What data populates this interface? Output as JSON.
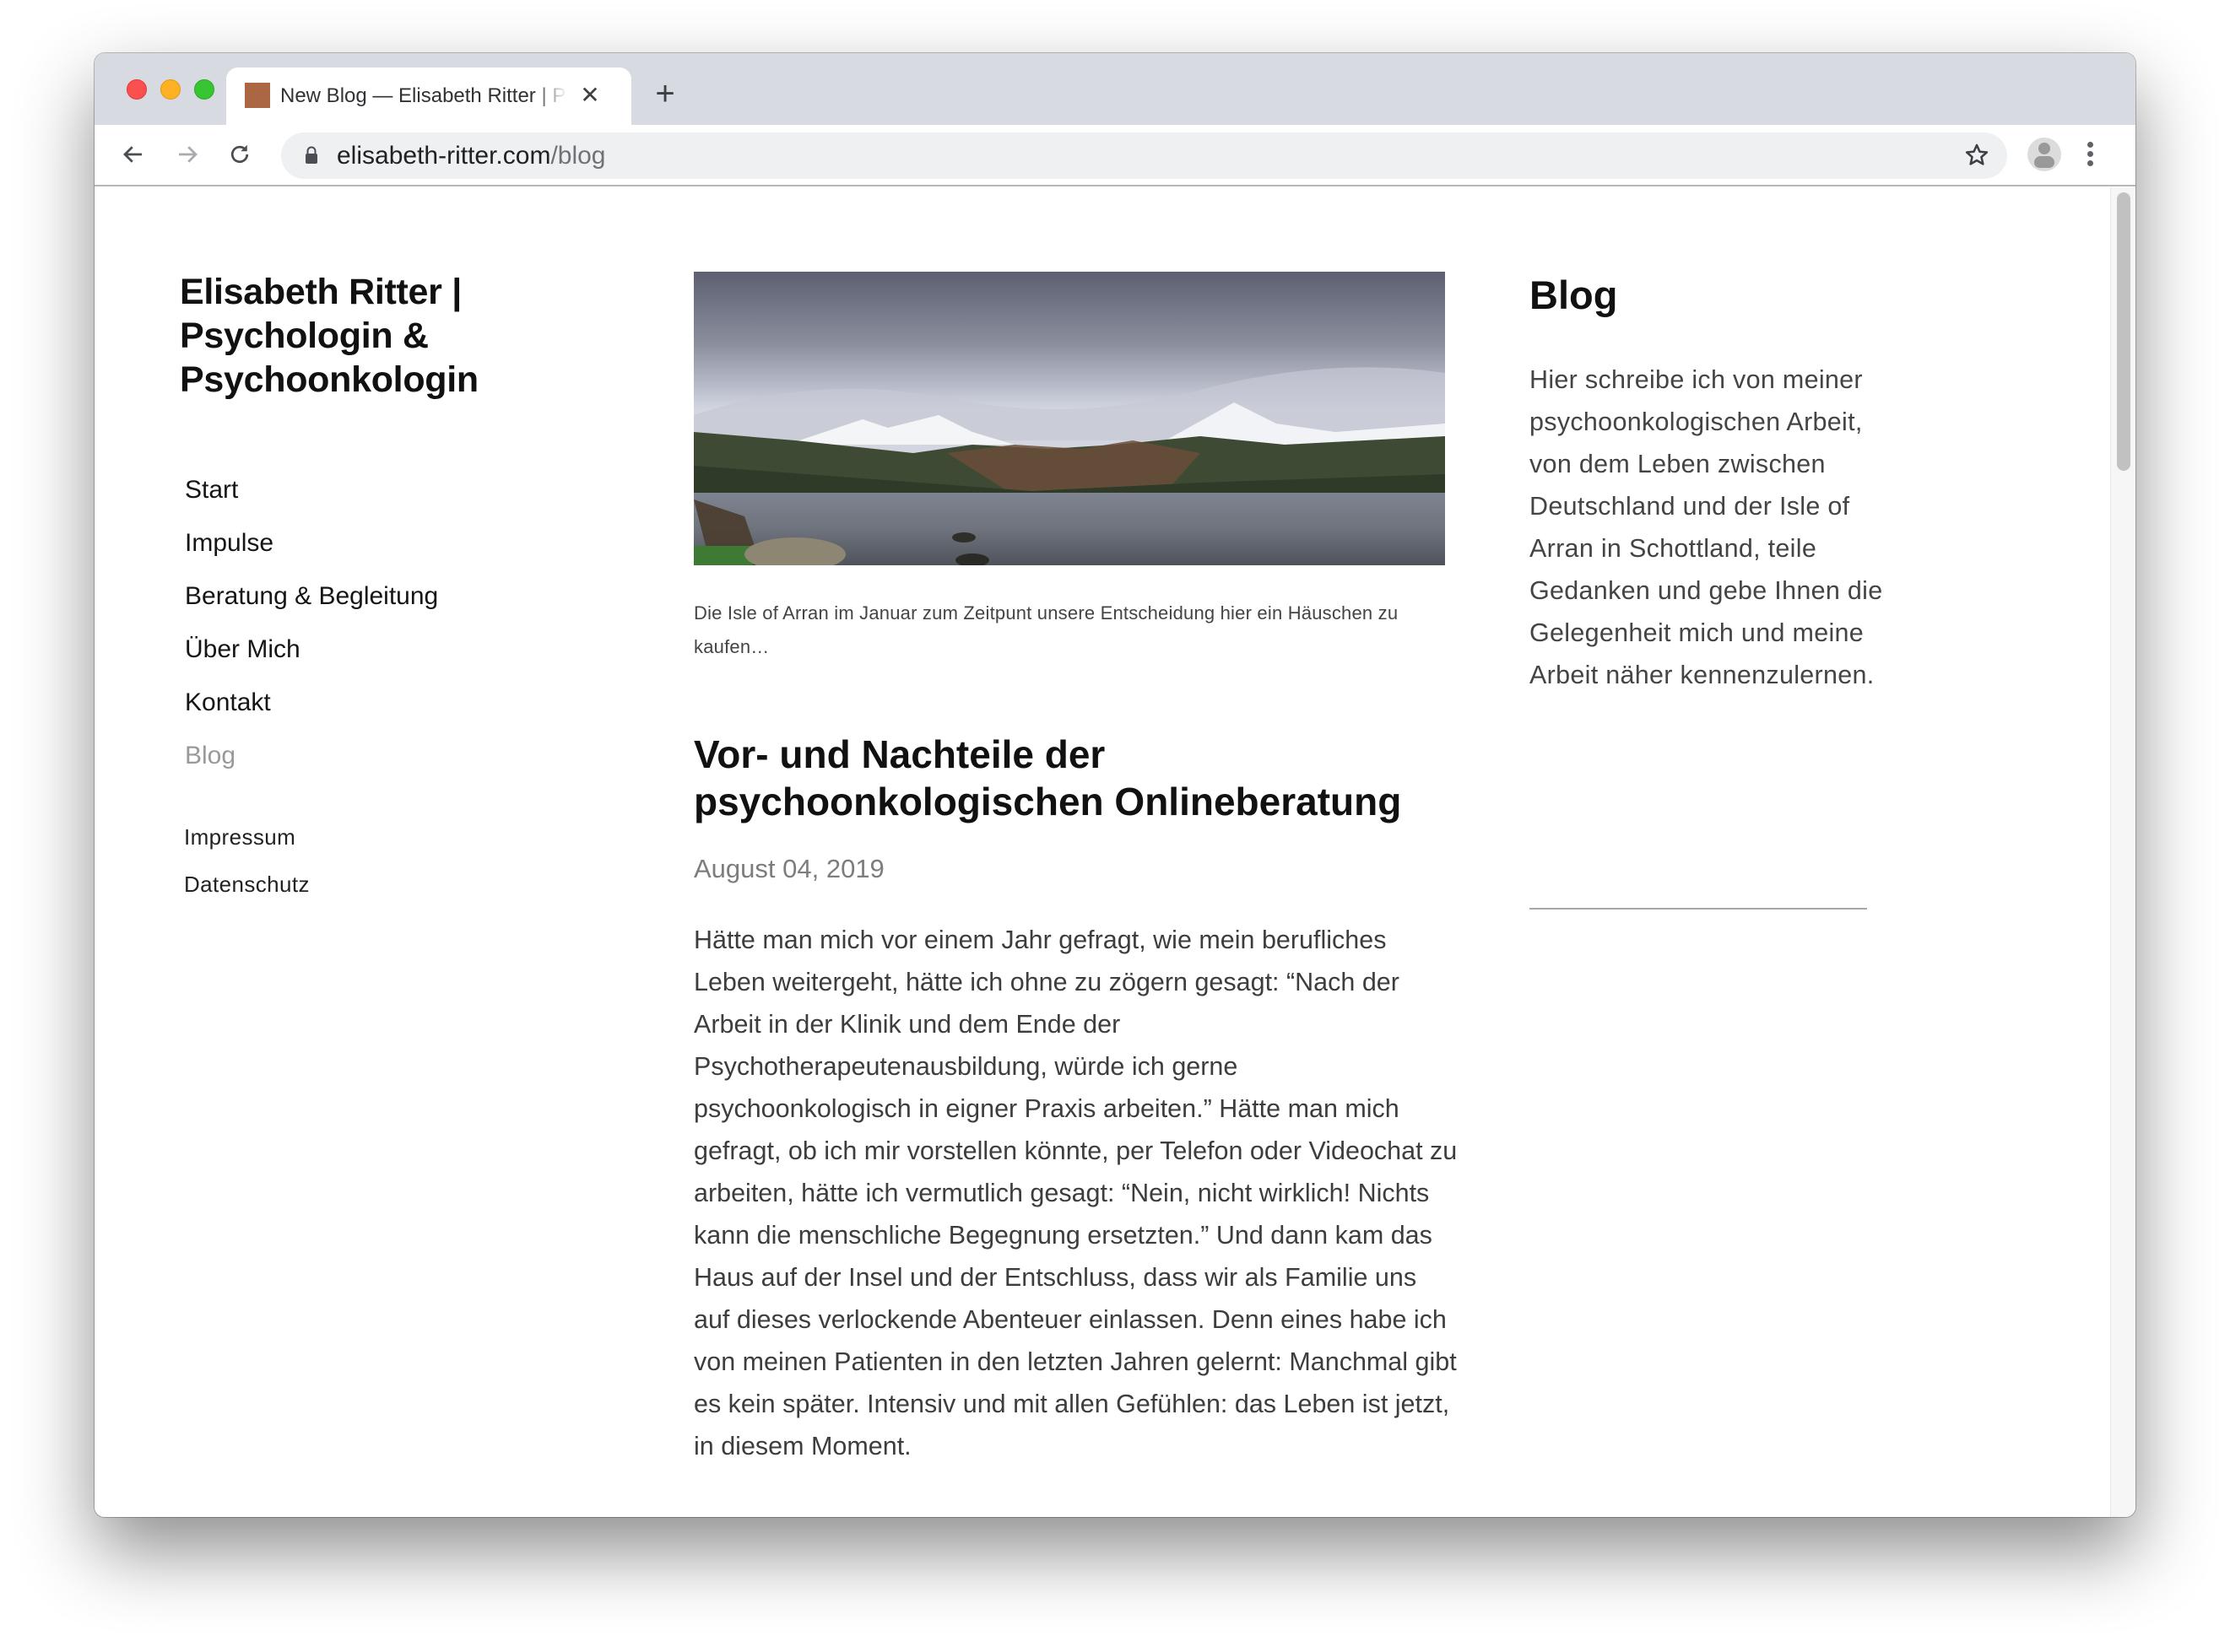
{
  "browser": {
    "tab": {
      "title": "New Blog — Elisabeth Ritter | Psychologin & Psychoonkologin",
      "favicon_color": "#ab6644",
      "close_glyph": "✕"
    },
    "new_tab_glyph": "+",
    "url": {
      "domain": "elisabeth-ritter.com",
      "path": "/blog"
    },
    "icons": [
      "back-arrow-icon",
      "forward-arrow-icon",
      "reload-icon",
      "lock-icon",
      "bookmark-star-icon",
      "profile-avatar-icon",
      "more-menu-icon"
    ]
  },
  "site": {
    "title": "Elisabeth Ritter | Psychologin & Psychoonkologin",
    "nav": [
      {
        "label": "Start",
        "active": false
      },
      {
        "label": "Impulse",
        "active": false
      },
      {
        "label": "Beratung & Begleitung",
        "active": false
      },
      {
        "label": "Über Mich",
        "active": false
      },
      {
        "label": "Kontakt",
        "active": false
      },
      {
        "label": "Blog",
        "active": true
      }
    ],
    "footer_links": [
      "Impressum",
      "Datenschutz"
    ]
  },
  "post": {
    "image_alt": "Isle of Arran landscape with snow-covered mountains and a lake",
    "caption": "Die Isle of Arran im Januar zum Zeitpunt unsere Entscheidung hier ein Häuschen zu kaufen…",
    "title": "Vor- und Nachteile der psychoonkologischen Onlineberatung",
    "date": "August 04, 2019",
    "body": "Hätte man mich vor einem Jahr gefragt, wie mein berufliches Leben weitergeht, hätte ich ohne zu zögern gesagt: “Nach der Arbeit in der Klinik und dem Ende der Psychotherapeutenausbildung, würde ich gerne psychoonkologisch in eigner Praxis arbeiten.” Hätte man mich gefragt, ob ich mir vorstellen könnte, per Telefon oder Videochat zu arbeiten, hätte ich vermutlich gesagt: “Nein, nicht wirklich! Nichts kann die menschliche Begegnung ersetzten.” Und dann kam das Haus auf der Insel und der Entschluss, dass wir als Familie uns auf dieses verlockende Abenteuer einlassen. Denn eines habe ich von meinen Patienten in den letzten Jahren gelernt: Manchmal gibt es kein später. Intensiv und mit allen Gefühlen: das Leben ist jetzt, in diesem Moment."
  },
  "sidebar": {
    "title": "Blog",
    "text": "Hier schreibe ich von meiner psychoonkologischen Arbeit, von dem Leben zwischen Deutschland und der Isle of Arran in Schottland, teile Gedanken und gebe Ihnen die Gelegenheit mich und meine Arbeit näher kennenzulernen."
  }
}
